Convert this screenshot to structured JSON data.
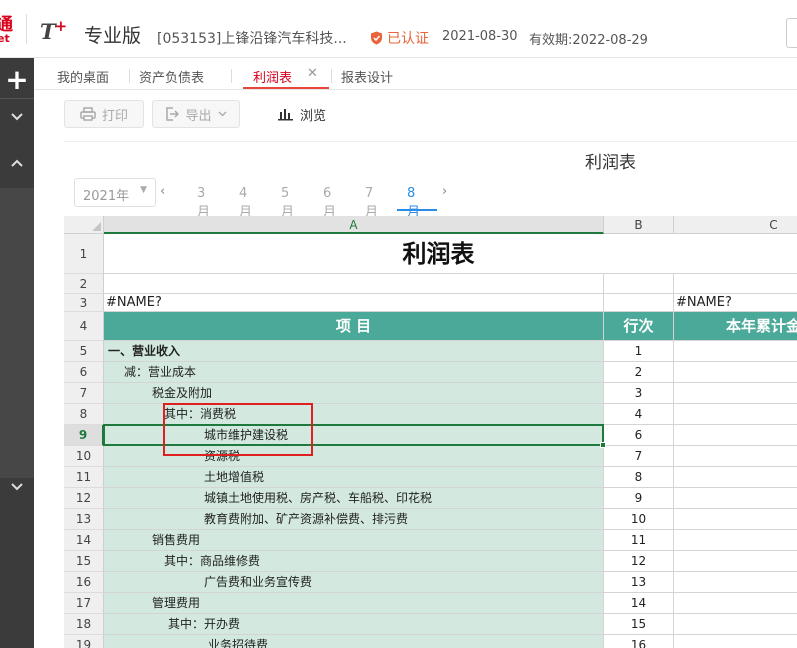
{
  "header": {
    "brand_top": "通",
    "brand_bottom": "et",
    "product": "T",
    "product_plus": "+",
    "edition": "专业版",
    "company": "[053153]上锋沿锋汽车科技...",
    "certified": "已认证",
    "date": "2021-08-30",
    "validity": "有效期:2022-08-29"
  },
  "tabs": [
    {
      "label": "我的桌面"
    },
    {
      "label": "资产负债表"
    },
    {
      "label": "利润表"
    },
    {
      "label": "报表设计"
    }
  ],
  "toolbar": {
    "print_label": "打印",
    "export_label": "导出",
    "browse_label": "浏览"
  },
  "report_title": "利润表",
  "period": {
    "year": "2021年",
    "months": [
      "3月",
      "4月",
      "5月",
      "6月",
      "7月",
      "8月"
    ],
    "active_month": "8月"
  },
  "sheet": {
    "columns": [
      "A",
      "B",
      "C"
    ],
    "selected_row": "9",
    "title_cell": "利润表",
    "name_error": "#NAME?",
    "header_item": "项  目",
    "header_line": "行次",
    "header_ytd": "本年累计金额",
    "rows": [
      {
        "n": "5",
        "item": "一、营业收入",
        "line": "1"
      },
      {
        "n": "6",
        "item": "减：营业成本",
        "line": "2"
      },
      {
        "n": "7",
        "item": "税金及附加",
        "line": "3"
      },
      {
        "n": "8",
        "item": "其中：消费税",
        "line": "4"
      },
      {
        "n": "9",
        "item": "城市维护建设税",
        "line": "6"
      },
      {
        "n": "10",
        "item": "资源税",
        "line": "7"
      },
      {
        "n": "11",
        "item": "土地增值税",
        "line": "8"
      },
      {
        "n": "12",
        "item": "城镇土地使用税、房产税、车船税、印花税",
        "line": "9"
      },
      {
        "n": "13",
        "item": "教育费附加、矿产资源补偿费、排污费",
        "line": "10"
      },
      {
        "n": "14",
        "item": "销售费用",
        "line": "11"
      },
      {
        "n": "15",
        "item": "其中：商品维修费",
        "line": "12"
      },
      {
        "n": "16",
        "item": "广告费和业务宣传费",
        "line": "13"
      },
      {
        "n": "17",
        "item": "管理费用",
        "line": "14"
      },
      {
        "n": "18",
        "item": "其中：开办费",
        "line": "15"
      },
      {
        "n": "19",
        "item": "业务招待费",
        "line": "16"
      }
    ]
  },
  "colors": {
    "brand_red": "#d9001b",
    "header_green": "#4ba99a",
    "item_green": "#d3e9df",
    "accent_blue": "#2a8ce8",
    "selection_green": "#1e7a3c",
    "highlight_red": "#e02020"
  }
}
